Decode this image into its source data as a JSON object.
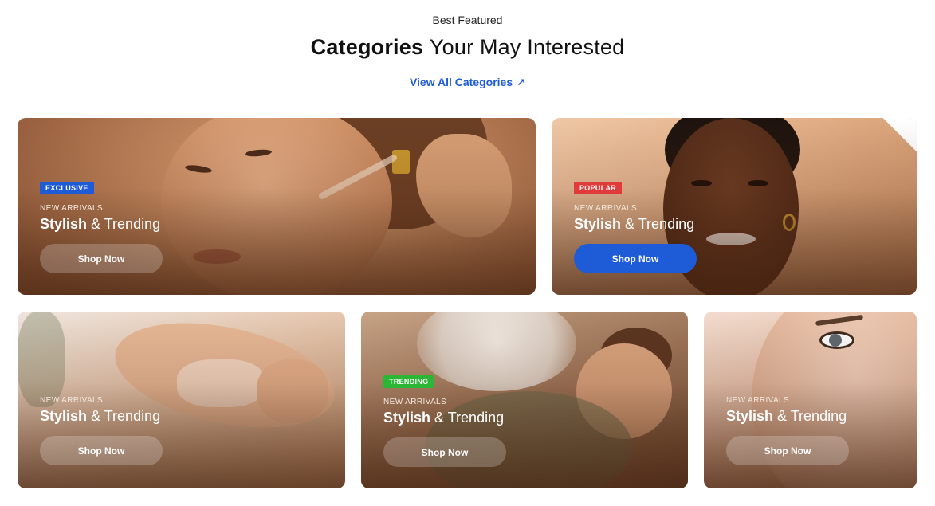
{
  "header": {
    "eyebrow": "Best Featured",
    "title_strong": "Categories",
    "title_rest": "Your May Interested",
    "view_all": "View All Categories",
    "view_all_icon": "arrow-up-right-icon"
  },
  "colors": {
    "accent": "#1e5bd6",
    "badge_exclusive": "#1e5bd6",
    "badge_popular": "#e03a3a",
    "badge_trending": "#2bb636"
  },
  "cards": [
    {
      "badge": "EXCLUSIVE",
      "kicker": "NEW ARRIVALS",
      "heading_bold": "Stylish",
      "heading_rest": "& Trending",
      "button": "Shop Now"
    },
    {
      "badge": "POPULAR",
      "kicker": "NEW ARRIVALS",
      "heading_bold": "Stylish",
      "heading_rest": "& Trending",
      "button": "Shop Now"
    },
    {
      "badge": "",
      "kicker": "NEW ARRIVALS",
      "heading_bold": "Stylish",
      "heading_rest": "& Trending",
      "button": "Shop Now"
    },
    {
      "badge": "TRENDING",
      "kicker": "NEW ARRIVALS",
      "heading_bold": "Stylish",
      "heading_rest": "& Trending",
      "button": "Shop Now"
    },
    {
      "badge": "",
      "kicker": "NEW ARRIVALS",
      "heading_bold": "Stylish",
      "heading_rest": "& Trending",
      "button": "Shop Now"
    }
  ]
}
